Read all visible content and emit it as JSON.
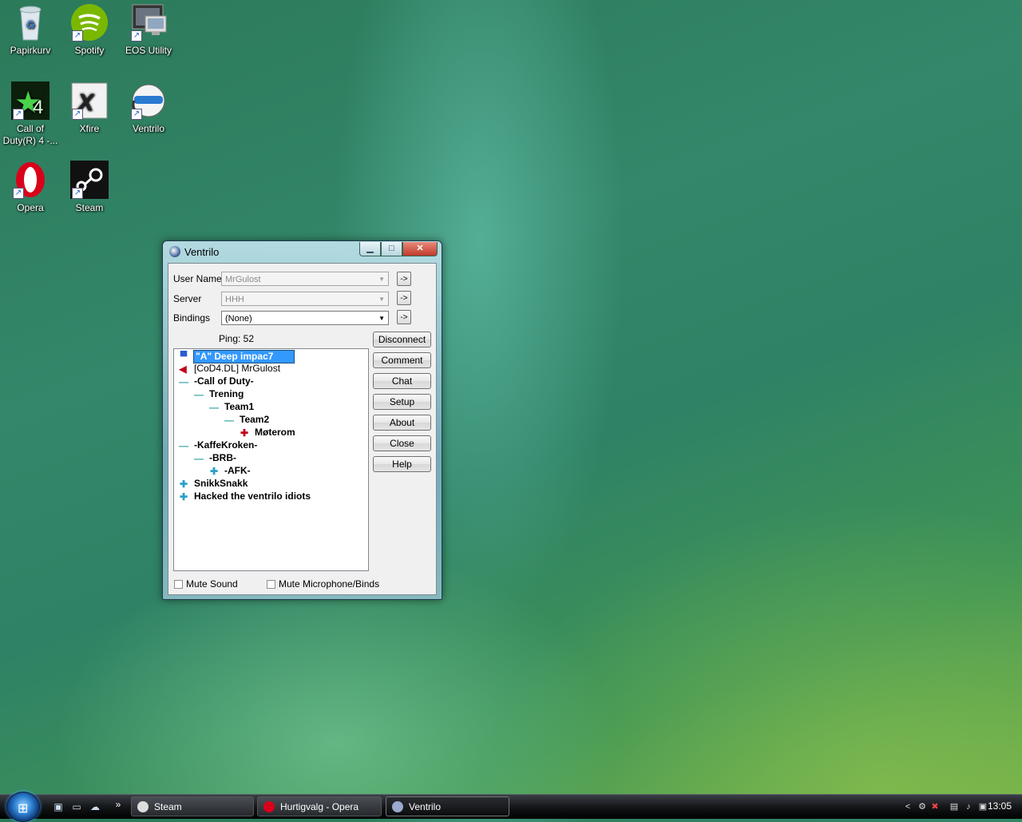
{
  "desktop": {
    "icons": [
      {
        "label": "Papirkurv"
      },
      {
        "label": "Spotify"
      },
      {
        "label": "EOS Utility"
      },
      {
        "label_line1": "Call of",
        "label_line2": "Duty(R) 4 -..."
      },
      {
        "label": "Xfire"
      },
      {
        "label": "Ventrilo"
      },
      {
        "label": "Opera"
      },
      {
        "label": "Steam"
      }
    ]
  },
  "window": {
    "title": "Ventrilo",
    "fields": {
      "username_label": "User Name",
      "username_value": "MrGulost",
      "server_label": "Server",
      "server_value": "HHH",
      "bindings_label": "Bindings",
      "bindings_value": "(None)",
      "arrow_button": "->"
    },
    "ping": "Ping: 52",
    "buttons": {
      "disconnect": "Disconnect",
      "comment": "Comment",
      "chat": "Chat",
      "setup": "Setup",
      "about": "About",
      "close": "Close",
      "help": "Help"
    },
    "tree": [
      {
        "text": "\"A\" Deep impac7",
        "type": "user-self"
      },
      {
        "text": "[CoD4.DL] MrGulost",
        "type": "user-speaking"
      },
      {
        "text": "-Call of Duty-",
        "type": "channel-open"
      },
      {
        "text": "Trening",
        "type": "channel-open"
      },
      {
        "text": "Team1",
        "type": "channel-open"
      },
      {
        "text": "Team2",
        "type": "channel-open"
      },
      {
        "text": "Møterom",
        "type": "channel-locked"
      },
      {
        "text": "-KaffeKroken-",
        "type": "channel-open"
      },
      {
        "text": "-BRB-",
        "type": "channel-open"
      },
      {
        "text": "-AFK-",
        "type": "channel-closed"
      },
      {
        "text": "SnikkSnakk",
        "type": "channel-closed"
      },
      {
        "text": "Hacked the ventrilo idiots",
        "type": "channel-closed"
      }
    ],
    "mute_sound": "Mute Sound",
    "mute_mic": "Mute Microphone/Binds"
  },
  "taskbar": {
    "tasks": [
      {
        "label": "Steam"
      },
      {
        "label": "Hurtigvalg - Opera"
      },
      {
        "label": "Ventrilo"
      }
    ],
    "overflow": "»",
    "tray_expand": "<",
    "clock": "13:05"
  },
  "colors": {
    "selection": "#3399ff",
    "taskbar": "#141618",
    "desktop": "#34876a"
  }
}
